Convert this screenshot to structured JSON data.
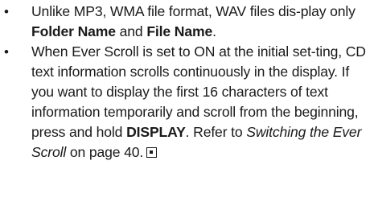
{
  "notes": [
    {
      "bullet": "•",
      "text_1": "Unlike MP3, WMA file format, WAV files dis-play only ",
      "bold_1": "Folder Name",
      "text_2": " and ",
      "bold_2": "File Name",
      "text_3": "."
    },
    {
      "bullet": "•",
      "text_1": "When Ever Scroll is set to ON at the initial set-ting, CD text information scrolls continuously in the display. If you want to display the first 16 characters of text information temporarily and scroll from the beginning, press and hold ",
      "bold_1": "DISPLAY",
      "text_2": ". Refer to ",
      "italic_1": "Switching the Ever Scroll",
      "text_3": " on page 40.",
      "end_icon": "stop-square-icon"
    }
  ]
}
